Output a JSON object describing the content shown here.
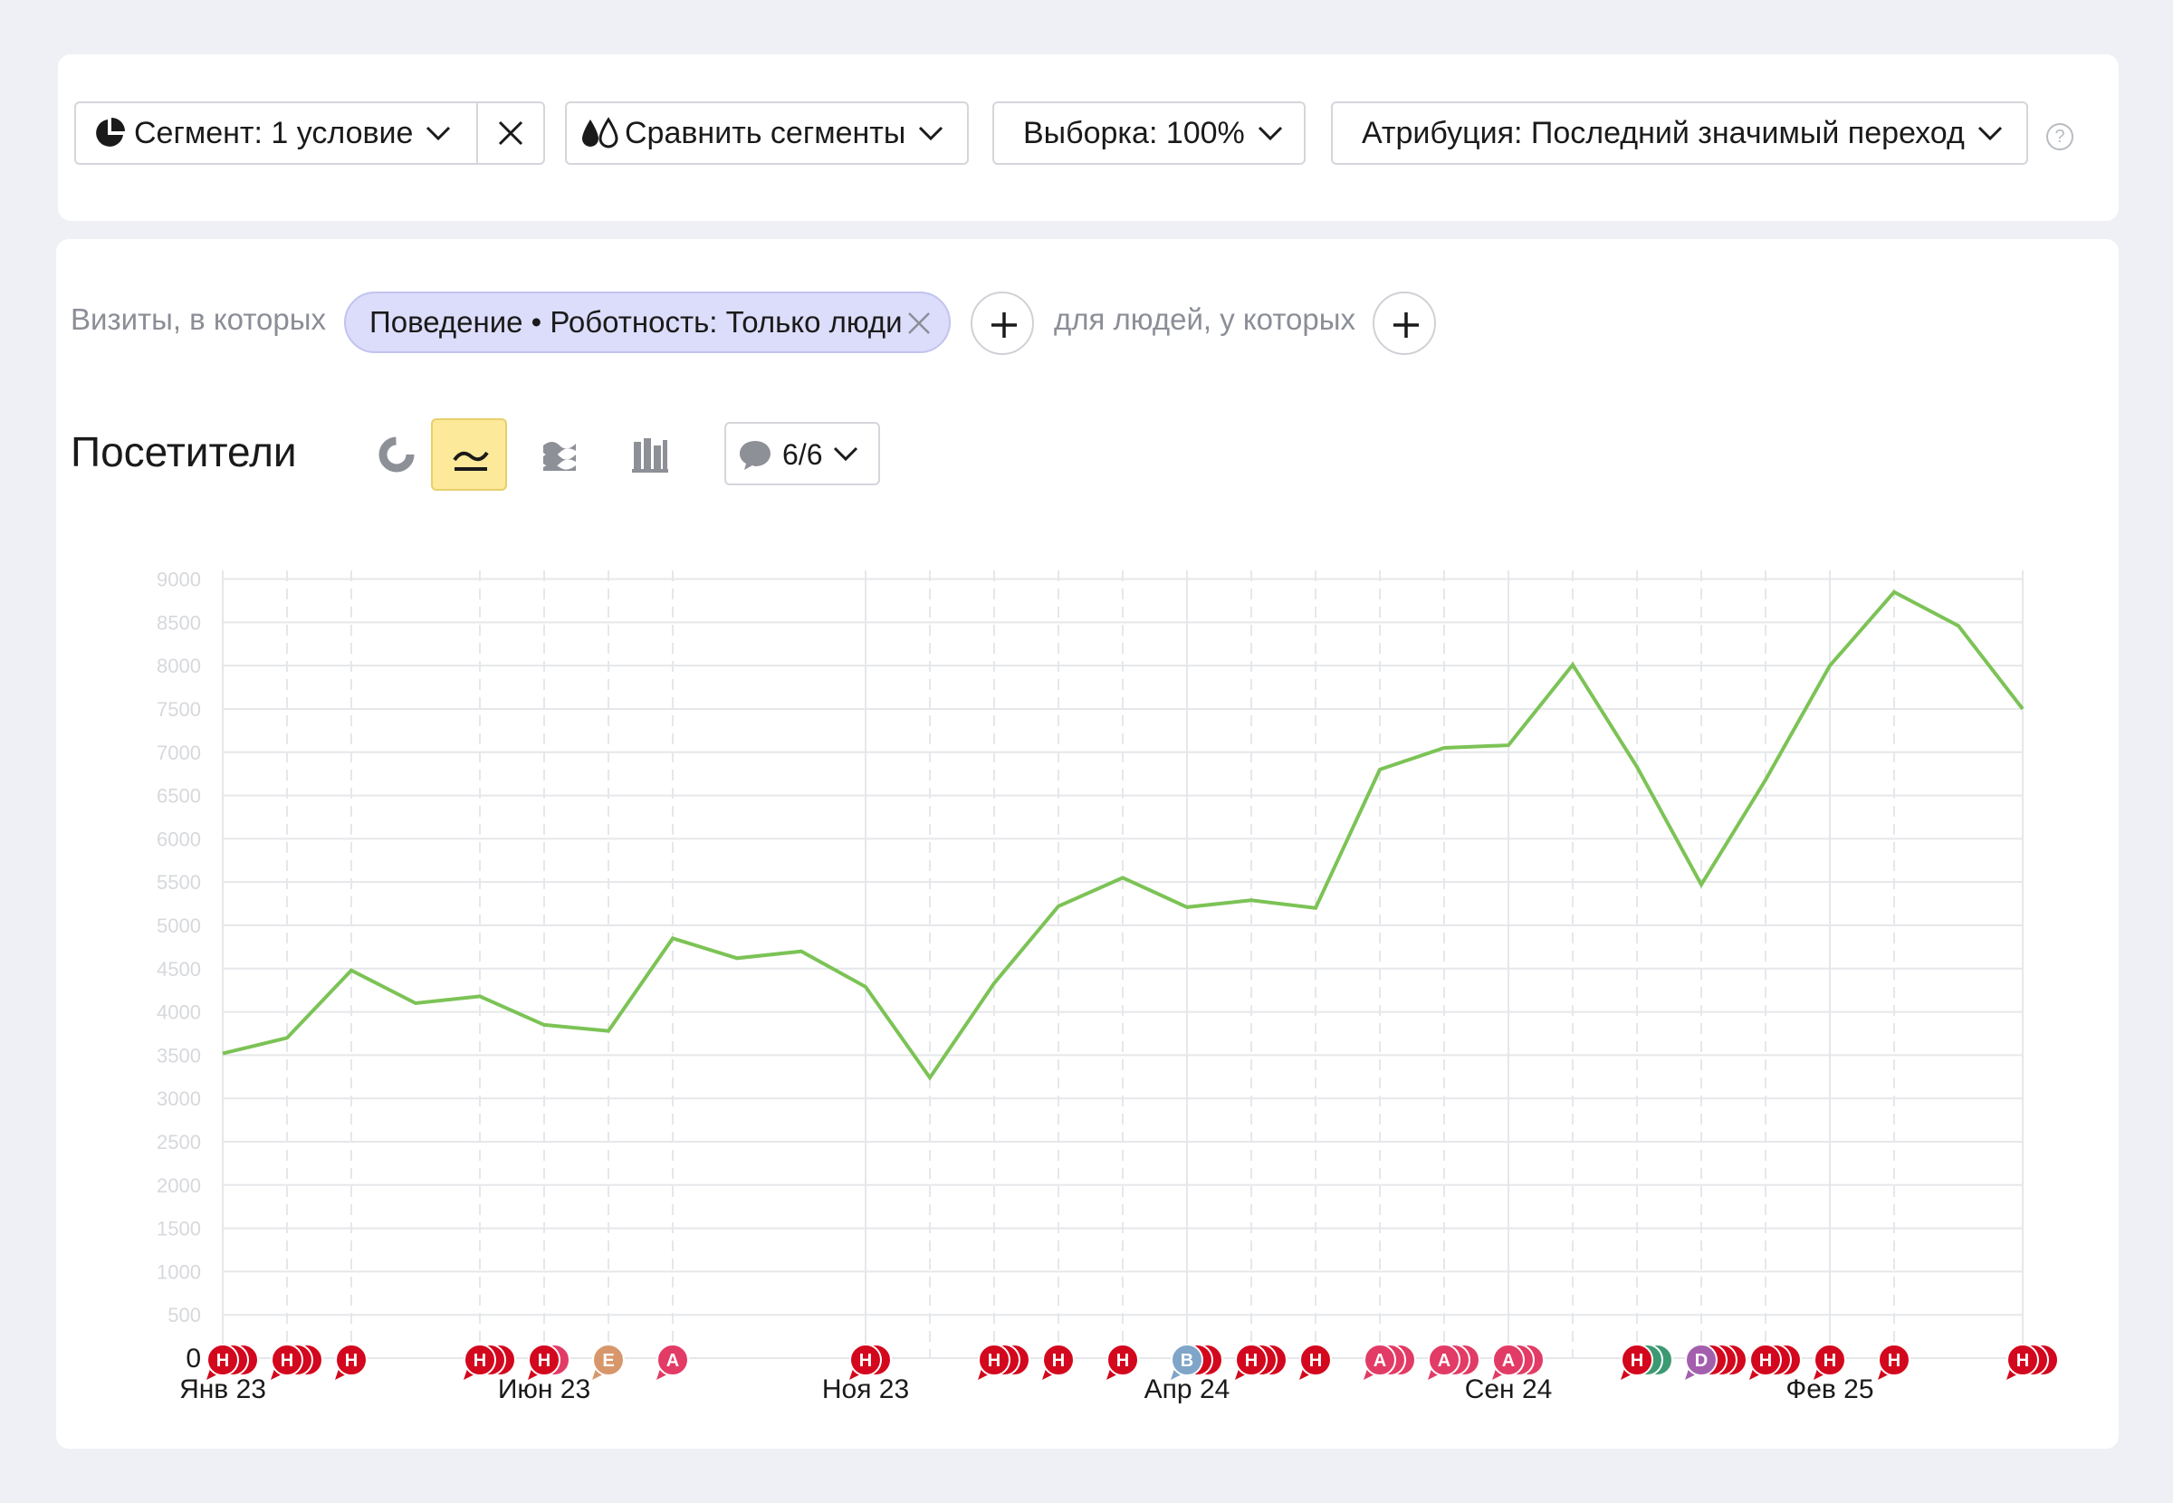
{
  "toolbar": {
    "segment_label": "Сегмент: 1 условие",
    "compare_label": "Сравнить сегменты",
    "sample_label": "Выборка: 100%",
    "attribution_label": "Атрибуция: Последний значимый переход",
    "help_text": "?"
  },
  "filter": {
    "visits_lead": "Визиты, в которых",
    "chip_label": "Поведение • Роботность: Только люди",
    "people_lead": "для людей, у которых"
  },
  "chart_header": {
    "title": "Посетители",
    "notes_count": "6/6"
  },
  "colors": {
    "line": "#7cc356",
    "grid": "#e6e7ea",
    "note_default": "#d3071d"
  },
  "chart_data": {
    "type": "line",
    "x": [
      "2023-01",
      "2023-02",
      "2023-03",
      "2023-04",
      "2023-05",
      "2023-06",
      "2023-07",
      "2023-08",
      "2023-09",
      "2023-10",
      "2023-11",
      "2023-12",
      "2024-01",
      "2024-02",
      "2024-03",
      "2024-04",
      "2024-05",
      "2024-06",
      "2024-07",
      "2024-08",
      "2024-09",
      "2024-10",
      "2024-11",
      "2024-12",
      "2025-01",
      "2025-02",
      "2025-03",
      "2025-04",
      "2025-05"
    ],
    "series": [
      {
        "values": [
          3520,
          3700,
          4480,
          4100,
          4180,
          3850,
          3780,
          4850,
          4620,
          4700,
          4290,
          3240,
          4330,
          5220,
          5550,
          5210,
          5290,
          5200,
          6800,
          7050,
          7080,
          8010,
          6830,
          5470,
          6680,
          8000,
          8850,
          8460,
          7500
        ]
      }
    ],
    "y_zero_label": "0",
    "y_ticks": [
      500,
      1000,
      1500,
      2000,
      2500,
      3000,
      3500,
      4000,
      4500,
      5000,
      5500,
      6000,
      6500,
      7000,
      7500,
      8000,
      8500,
      9000
    ],
    "ylim": [
      0,
      9100
    ],
    "x_tick_labels": [
      {
        "label": "Янв 23",
        "x": "2023-01"
      },
      {
        "label": "Июн 23",
        "x": "2023-06"
      },
      {
        "label": "Ноя 23",
        "x": "2023-11"
      },
      {
        "label": "Апр 24",
        "x": "2024-04"
      },
      {
        "label": "Сен 24",
        "x": "2024-09"
      },
      {
        "label": "Фев 25",
        "x": "2025-02"
      }
    ],
    "dashed_gridlines_at": [
      "2023-02",
      "2023-03",
      "2023-05",
      "2023-06",
      "2023-07",
      "2023-08",
      "2023-12",
      "2024-01",
      "2024-02",
      "2024-03",
      "2024-05",
      "2024-06",
      "2024-07",
      "2024-08",
      "2024-10",
      "2024-11",
      "2024-12",
      "2025-01",
      "2025-03"
    ],
    "solid_gridlines_at": [
      "2023-01",
      "2023-11",
      "2024-04",
      "2024-09",
      "2025-02",
      "2025-05"
    ],
    "notes": [
      {
        "x": "2023-01",
        "letter": "Н",
        "count": 3,
        "color": "#d3071d"
      },
      {
        "x": "2023-02",
        "letter": "Н",
        "count": 3,
        "color": "#d3071d"
      },
      {
        "x": "2023-03",
        "letter": "Н",
        "count": 1,
        "color": "#d3071d"
      },
      {
        "x": "2023-05",
        "letter": "Н",
        "count": 3,
        "color": "#d3071d"
      },
      {
        "x": "2023-06",
        "letter": "Н",
        "count": 2,
        "color": "#d3071d",
        "back_color": "#e23b66"
      },
      {
        "x": "2023-07",
        "letter": "E",
        "count": 1,
        "color": "#d8976b"
      },
      {
        "x": "2023-08",
        "letter": "A",
        "count": 1,
        "color": "#e23b66"
      },
      {
        "x": "2023-11",
        "letter": "Н",
        "count": 2,
        "color": "#d3071d"
      },
      {
        "x": "2024-01",
        "letter": "Н",
        "count": 3,
        "color": "#d3071d"
      },
      {
        "x": "2024-02",
        "letter": "Н",
        "count": 1,
        "color": "#d3071d"
      },
      {
        "x": "2024-03",
        "letter": "Н",
        "count": 1,
        "color": "#d3071d"
      },
      {
        "x": "2024-04",
        "letter": "B",
        "count": 3,
        "color": "#7fa5c8",
        "back_color": "#d3071d"
      },
      {
        "x": "2024-05",
        "letter": "Н",
        "count": 3,
        "color": "#d3071d"
      },
      {
        "x": "2024-06",
        "letter": "Н",
        "count": 1,
        "color": "#d3071d"
      },
      {
        "x": "2024-07",
        "letter": "A",
        "count": 3,
        "color": "#e23b66"
      },
      {
        "x": "2024-08",
        "letter": "A",
        "count": 3,
        "color": "#e23b66"
      },
      {
        "x": "2024-09",
        "letter": "A",
        "count": 3,
        "color": "#e23b66"
      },
      {
        "x": "2024-11",
        "letter": "Н",
        "count": 3,
        "color": "#d3071d",
        "back_color": "#3c9a73"
      },
      {
        "x": "2024-12",
        "letter": "D",
        "count": 4,
        "color": "#a35fae",
        "back_color": "#d3071d"
      },
      {
        "x": "2025-01",
        "letter": "Н",
        "count": 3,
        "color": "#d3071d"
      },
      {
        "x": "2025-02",
        "letter": "Н",
        "count": 1,
        "color": "#d3071d"
      },
      {
        "x": "2025-03",
        "letter": "Н",
        "count": 1,
        "color": "#d3071d"
      },
      {
        "x": "2025-05",
        "letter": "Н",
        "count": 3,
        "color": "#d3071d"
      }
    ]
  }
}
